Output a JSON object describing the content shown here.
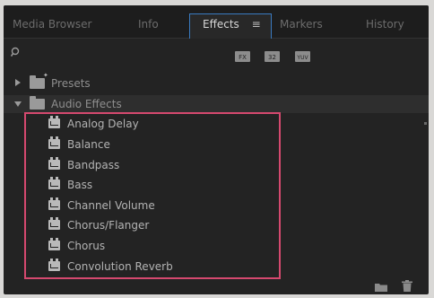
{
  "tabs": [
    {
      "label": "Media Browser",
      "active": false
    },
    {
      "label": "Info",
      "active": false
    },
    {
      "label": "Effects",
      "active": true
    },
    {
      "label": "Markers",
      "active": false
    },
    {
      "label": "History",
      "active": false
    }
  ],
  "effects_tab_menu_icon": "hamburger-menu-icon",
  "toolbar": {
    "buttons": [
      "accelerated-effects-icon",
      "32-bit-effects-icon",
      "yuv-effects-icon"
    ],
    "accelerated_label": "FX",
    "bit32_label": "32",
    "yuv_label": "YUV"
  },
  "tree": {
    "presets": {
      "label": "Presets",
      "expanded": false
    },
    "audio_effects": {
      "label": "Audio Effects",
      "expanded": true
    }
  },
  "audio_effects": [
    "Analog Delay",
    "Balance",
    "Bandpass",
    "Bass",
    "Channel Volume",
    "Chorus/Flanger",
    "Chorus",
    "Convolution Reverb"
  ],
  "footer_icons": [
    "new-bin-icon",
    "trash-icon"
  ],
  "colors": {
    "panel_bg": "#232323",
    "active_tab_border": "#3a7ac0",
    "highlight_box": "#d5496f"
  }
}
